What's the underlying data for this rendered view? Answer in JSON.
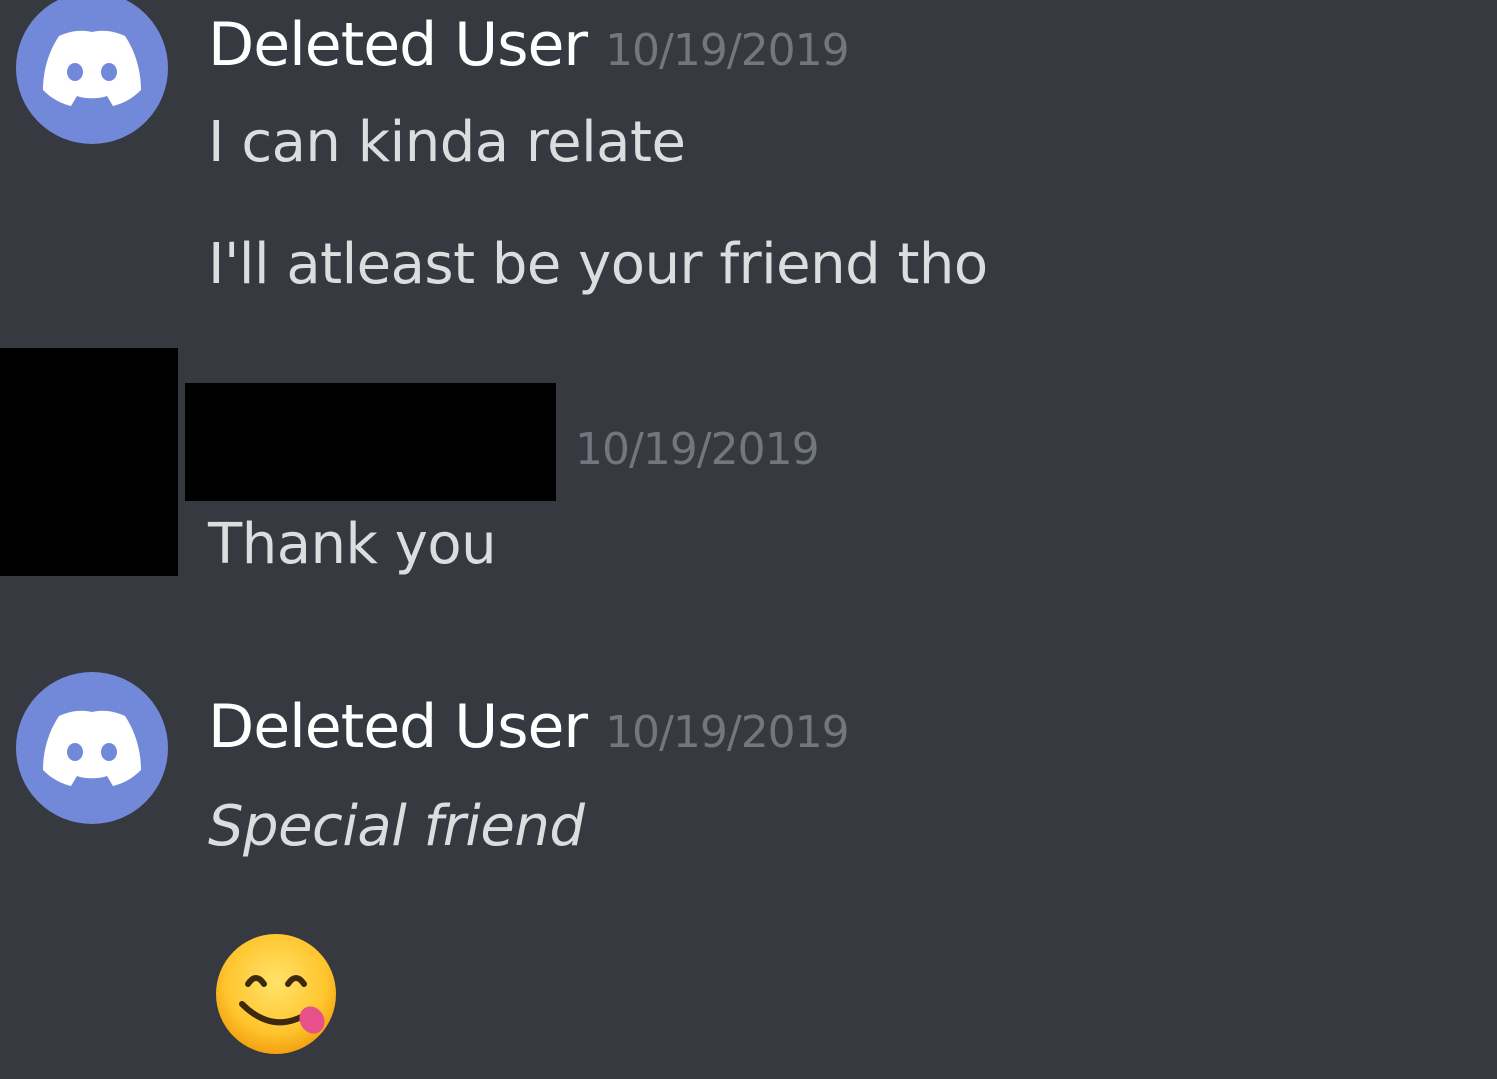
{
  "messages": [
    {
      "author": "Deleted User",
      "timestamp": "10/19/2019",
      "avatar_icon": "discord-default-avatar-icon",
      "lines": [
        "I can kinda relate",
        "I'll atleast be your friend tho"
      ]
    },
    {
      "author": "",
      "timestamp": "10/19/2019",
      "avatar_icon": "redacted",
      "lines": [
        "Thank you"
      ]
    },
    {
      "author": "Deleted User",
      "timestamp": "10/19/2019",
      "avatar_icon": "discord-default-avatar-icon",
      "lines": [
        "Special friend"
      ],
      "emoji": "face-savoring-food-emoji"
    }
  ],
  "colors": {
    "background": "#36393f",
    "avatar": "#7289da",
    "username": "#ffffff",
    "timestamp": "#72767d",
    "message_text": "#dcddde"
  }
}
